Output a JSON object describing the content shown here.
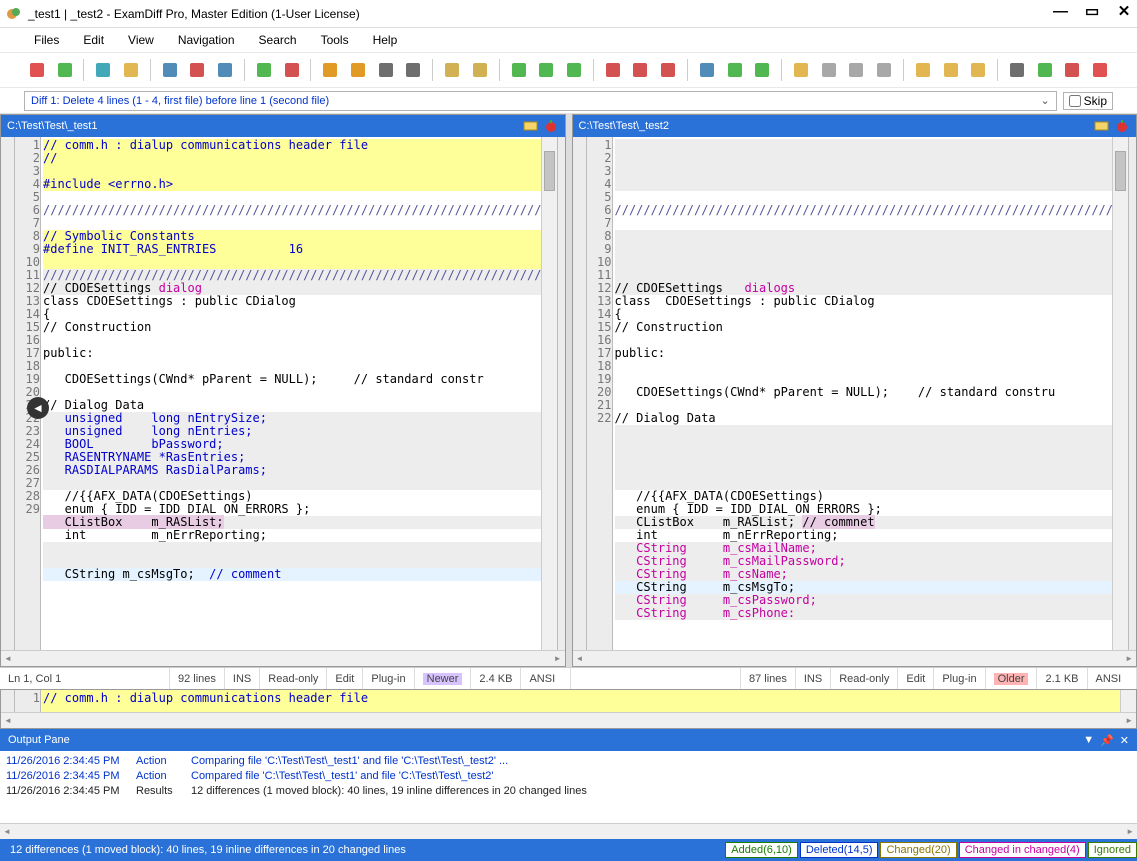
{
  "title": "_test1 | _test2 - ExamDiff Pro, Master Edition (1-User License)",
  "menu": [
    "Files",
    "Edit",
    "View",
    "Navigation",
    "Search",
    "Tools",
    "Help"
  ],
  "diff_desc": "Diff 1: Delete 4 lines (1 - 4, first file) before line 1 (second file)",
  "skip_label": "Skip",
  "left": {
    "path": "C:\\Test\\Test\\_test1",
    "nums": [
      1,
      2,
      3,
      4,
      5,
      6,
      "",
      7,
      8,
      9,
      10,
      11,
      12,
      13,
      14,
      "",
      15,
      "",
      16,
      17,
      18,
      19,
      20,
      21,
      22,
      23,
      24,
      25,
      26,
      27,
      28,
      "",
      "",
      29
    ],
    "lines": [
      {
        "t": "// comm.h : dialup communications header file",
        "bg": "bg-del",
        "cls": "kw"
      },
      {
        "t": "//",
        "bg": "bg-del",
        "cls": "kw"
      },
      {
        "t": "",
        "bg": "bg-del"
      },
      {
        "t": "#include <errno.h>",
        "bg": "bg-del",
        "cls": "kw"
      },
      {
        "t": "",
        "bg": ""
      },
      {
        "t": "/////////////////////////////////////////////////////////////////////////",
        "bg": "",
        "cls": "cm"
      },
      {
        "t": "",
        "bg": ""
      },
      {
        "t": "// Symbolic Constants",
        "bg": "bg-del",
        "cls": "kw"
      },
      {
        "t": "#define INIT_RAS_ENTRIES          16",
        "bg": "bg-del",
        "cls": "kw"
      },
      {
        "t": "",
        "bg": "bg-del"
      },
      {
        "t": "/////////////////////////////////////////////////////////////////////////",
        "bg": "bg-chg",
        "cls": "cm"
      },
      {
        "t": "// CDOESettings dialog",
        "bg": "bg-chg",
        "par": [
          {
            "t": "// CDOESettings "
          },
          {
            "t": "dialog",
            "c": "chg1"
          }
        ]
      },
      {
        "t": "class CDOESettings : public CDialog",
        "bg": ""
      },
      {
        "t": "{",
        "bg": ""
      },
      {
        "t": "// Construction",
        "bg": ""
      },
      {
        "t": "",
        "bg": ""
      },
      {
        "t": "public:",
        "bg": ""
      },
      {
        "t": "",
        "bg": ""
      },
      {
        "t": "   CDOESettings(CWnd* pParent = NULL);     // standard constr",
        "bg": ""
      },
      {
        "t": "",
        "bg": ""
      },
      {
        "t": "// Dialog Data",
        "bg": ""
      },
      {
        "t": "   unsigned    long nEntrySize;",
        "bg": "bg-chg",
        "cls": "kw"
      },
      {
        "t": "   unsigned    long nEntries;",
        "bg": "bg-chg",
        "cls": "kw"
      },
      {
        "t": "   BOOL        bPassword;",
        "bg": "bg-chg",
        "cls": "kw"
      },
      {
        "t": "   RASENTRYNAME *RasEntries;",
        "bg": "bg-chg",
        "cls": "kw"
      },
      {
        "t": "   RASDIALPARAMS RasDialParams;",
        "bg": "bg-chg",
        "cls": "kw"
      },
      {
        "t": "",
        "bg": "bg-chg"
      },
      {
        "t": "   //{{AFX_DATA(CDOESettings)",
        "bg": ""
      },
      {
        "t": "   enum { IDD = IDD_DIAL_ON_ERRORS };",
        "bg": ""
      },
      {
        "t": "   CListBox    m_RASList;",
        "bg": "bg-chg",
        "par": [
          {
            "t": "   CListBox    m_RASList;",
            "c": "chg2"
          }
        ]
      },
      {
        "t": "   int         m_nErrReporting;",
        "bg": ""
      },
      {
        "t": "",
        "bg": "bg-chg"
      },
      {
        "t": "",
        "bg": "bg-chg"
      },
      {
        "t": "   CString m_csMsgTo;  // comment",
        "bg": "bg-mov",
        "par": [
          {
            "t": "   CString m_csMsgTo;  "
          },
          {
            "t": "// comment",
            "c": "kw"
          }
        ]
      }
    ]
  },
  "right": {
    "path": "C:\\Test\\Test\\_test2",
    "nums": [
      "",
      "",
      "",
      "",
      "",
      1,
      2,
      "",
      "",
      "",
      "",
      3,
      4,
      5,
      6,
      "",
      7,
      8,
      9,
      10,
      11,
      12,
      "",
      "",
      "",
      "",
      "",
      13,
      14,
      15,
      16,
      17,
      18,
      19,
      20,
      21,
      22
    ],
    "lines": [
      {
        "t": "",
        "bg": "bg-chg"
      },
      {
        "t": "",
        "bg": "bg-chg"
      },
      {
        "t": "",
        "bg": "bg-chg"
      },
      {
        "t": "",
        "bg": "bg-chg"
      },
      {
        "t": "",
        "bg": ""
      },
      {
        "t": "/////////////////////////////////////////////////////////////////////////",
        "bg": "",
        "cls": "cm"
      },
      {
        "t": "",
        "bg": ""
      },
      {
        "t": "",
        "bg": "bg-chg"
      },
      {
        "t": "",
        "bg": "bg-chg"
      },
      {
        "t": "",
        "bg": "bg-chg"
      },
      {
        "t": "",
        "bg": "bg-chg"
      },
      {
        "t": "// CDOESettings   dialogs",
        "bg": "bg-chg",
        "par": [
          {
            "t": "// CDOESettings   "
          },
          {
            "t": "dialogs",
            "c": "chg1"
          }
        ]
      },
      {
        "t": "class  CDOESettings : public CDialog",
        "bg": ""
      },
      {
        "t": "{",
        "bg": ""
      },
      {
        "t": "// Construction",
        "bg": ""
      },
      {
        "t": "",
        "bg": ""
      },
      {
        "t": "public:",
        "bg": ""
      },
      {
        "t": "",
        "bg": ""
      },
      {
        "t": "",
        "bg": ""
      },
      {
        "t": "   CDOESettings(CWnd* pParent = NULL);    // standard constru",
        "bg": ""
      },
      {
        "t": "",
        "bg": ""
      },
      {
        "t": "// Dialog Data",
        "bg": ""
      },
      {
        "t": "",
        "bg": "bg-chg"
      },
      {
        "t": "",
        "bg": "bg-chg"
      },
      {
        "t": "",
        "bg": "bg-chg"
      },
      {
        "t": "",
        "bg": "bg-chg"
      },
      {
        "t": "",
        "bg": "bg-chg"
      },
      {
        "t": "   //{{AFX_DATA(CDOESettings)",
        "bg": ""
      },
      {
        "t": "   enum { IDD = IDD_DIAL_ON_ERRORS };",
        "bg": ""
      },
      {
        "t": "   CListBox    m_RASList; // commnet",
        "bg": "bg-chg",
        "par": [
          {
            "t": "   CListBox    m_RASList; "
          },
          {
            "t": "// commnet",
            "c": "chg2"
          }
        ]
      },
      {
        "t": "   int         m_nErrReporting;",
        "bg": ""
      },
      {
        "t": "   CString     m_csMailName;",
        "bg": "bg-chg",
        "cls": "chg1"
      },
      {
        "t": "   CString     m_csMailPassword;",
        "bg": "bg-chg",
        "cls": "chg1"
      },
      {
        "t": "   CString     m_csName;",
        "bg": "bg-chg",
        "cls": "chg1"
      },
      {
        "t": "   CString     m_csMsgTo;",
        "bg": "bg-mov",
        "cls": ""
      },
      {
        "t": "   CString     m_csPassword;",
        "bg": "bg-chg",
        "cls": "chg1"
      },
      {
        "t": "   CString     m_csPhone:",
        "bg": "bg-chg",
        "cls": "chg1"
      }
    ]
  },
  "status_left": {
    "pos": "Ln 1, Col 1",
    "lines": "92 lines",
    "ins": "INS",
    "ro": "Read-only",
    "edit": "Edit",
    "plug": "Plug-in",
    "age": "Newer",
    "size": "2.4 KB",
    "enc": "ANSI"
  },
  "status_right": {
    "pos": "",
    "lines": "87 lines",
    "ins": "INS",
    "ro": "Read-only",
    "edit": "Edit",
    "plug": "Plug-in",
    "age": "Older",
    "size": "2.1 KB",
    "enc": "ANSI"
  },
  "bottom_line_num": "1",
  "bottom_line": "// comm.h : dialup communications header file",
  "output_title": "Output Pane",
  "output": [
    {
      "ts": "11/26/2016 2:34:45 PM",
      "typ": "Action",
      "msg": "Comparing file 'C:\\Test\\Test\\_test1' and file 'C:\\Test\\Test\\_test2' ..."
    },
    {
      "ts": "11/26/2016 2:34:45 PM",
      "typ": "Action",
      "msg": "Compared file 'C:\\Test\\Test\\_test1' and file 'C:\\Test\\Test\\_test2'"
    },
    {
      "ts": "11/26/2016 2:34:45 PM",
      "typ": "Results",
      "msg": "12 differences (1 moved block): 40 lines, 19 inline differences in 20 changed lines"
    }
  ],
  "footer_msg": "12 differences (1 moved block): 40 lines, 19 inline differences in 20 changed lines",
  "chips": {
    "added": "Added(6,10)",
    "deleted": "Deleted(14,5)",
    "changed": "Changed(20)",
    "cic": "Changed in changed(4)",
    "ignored": "Ignored"
  }
}
